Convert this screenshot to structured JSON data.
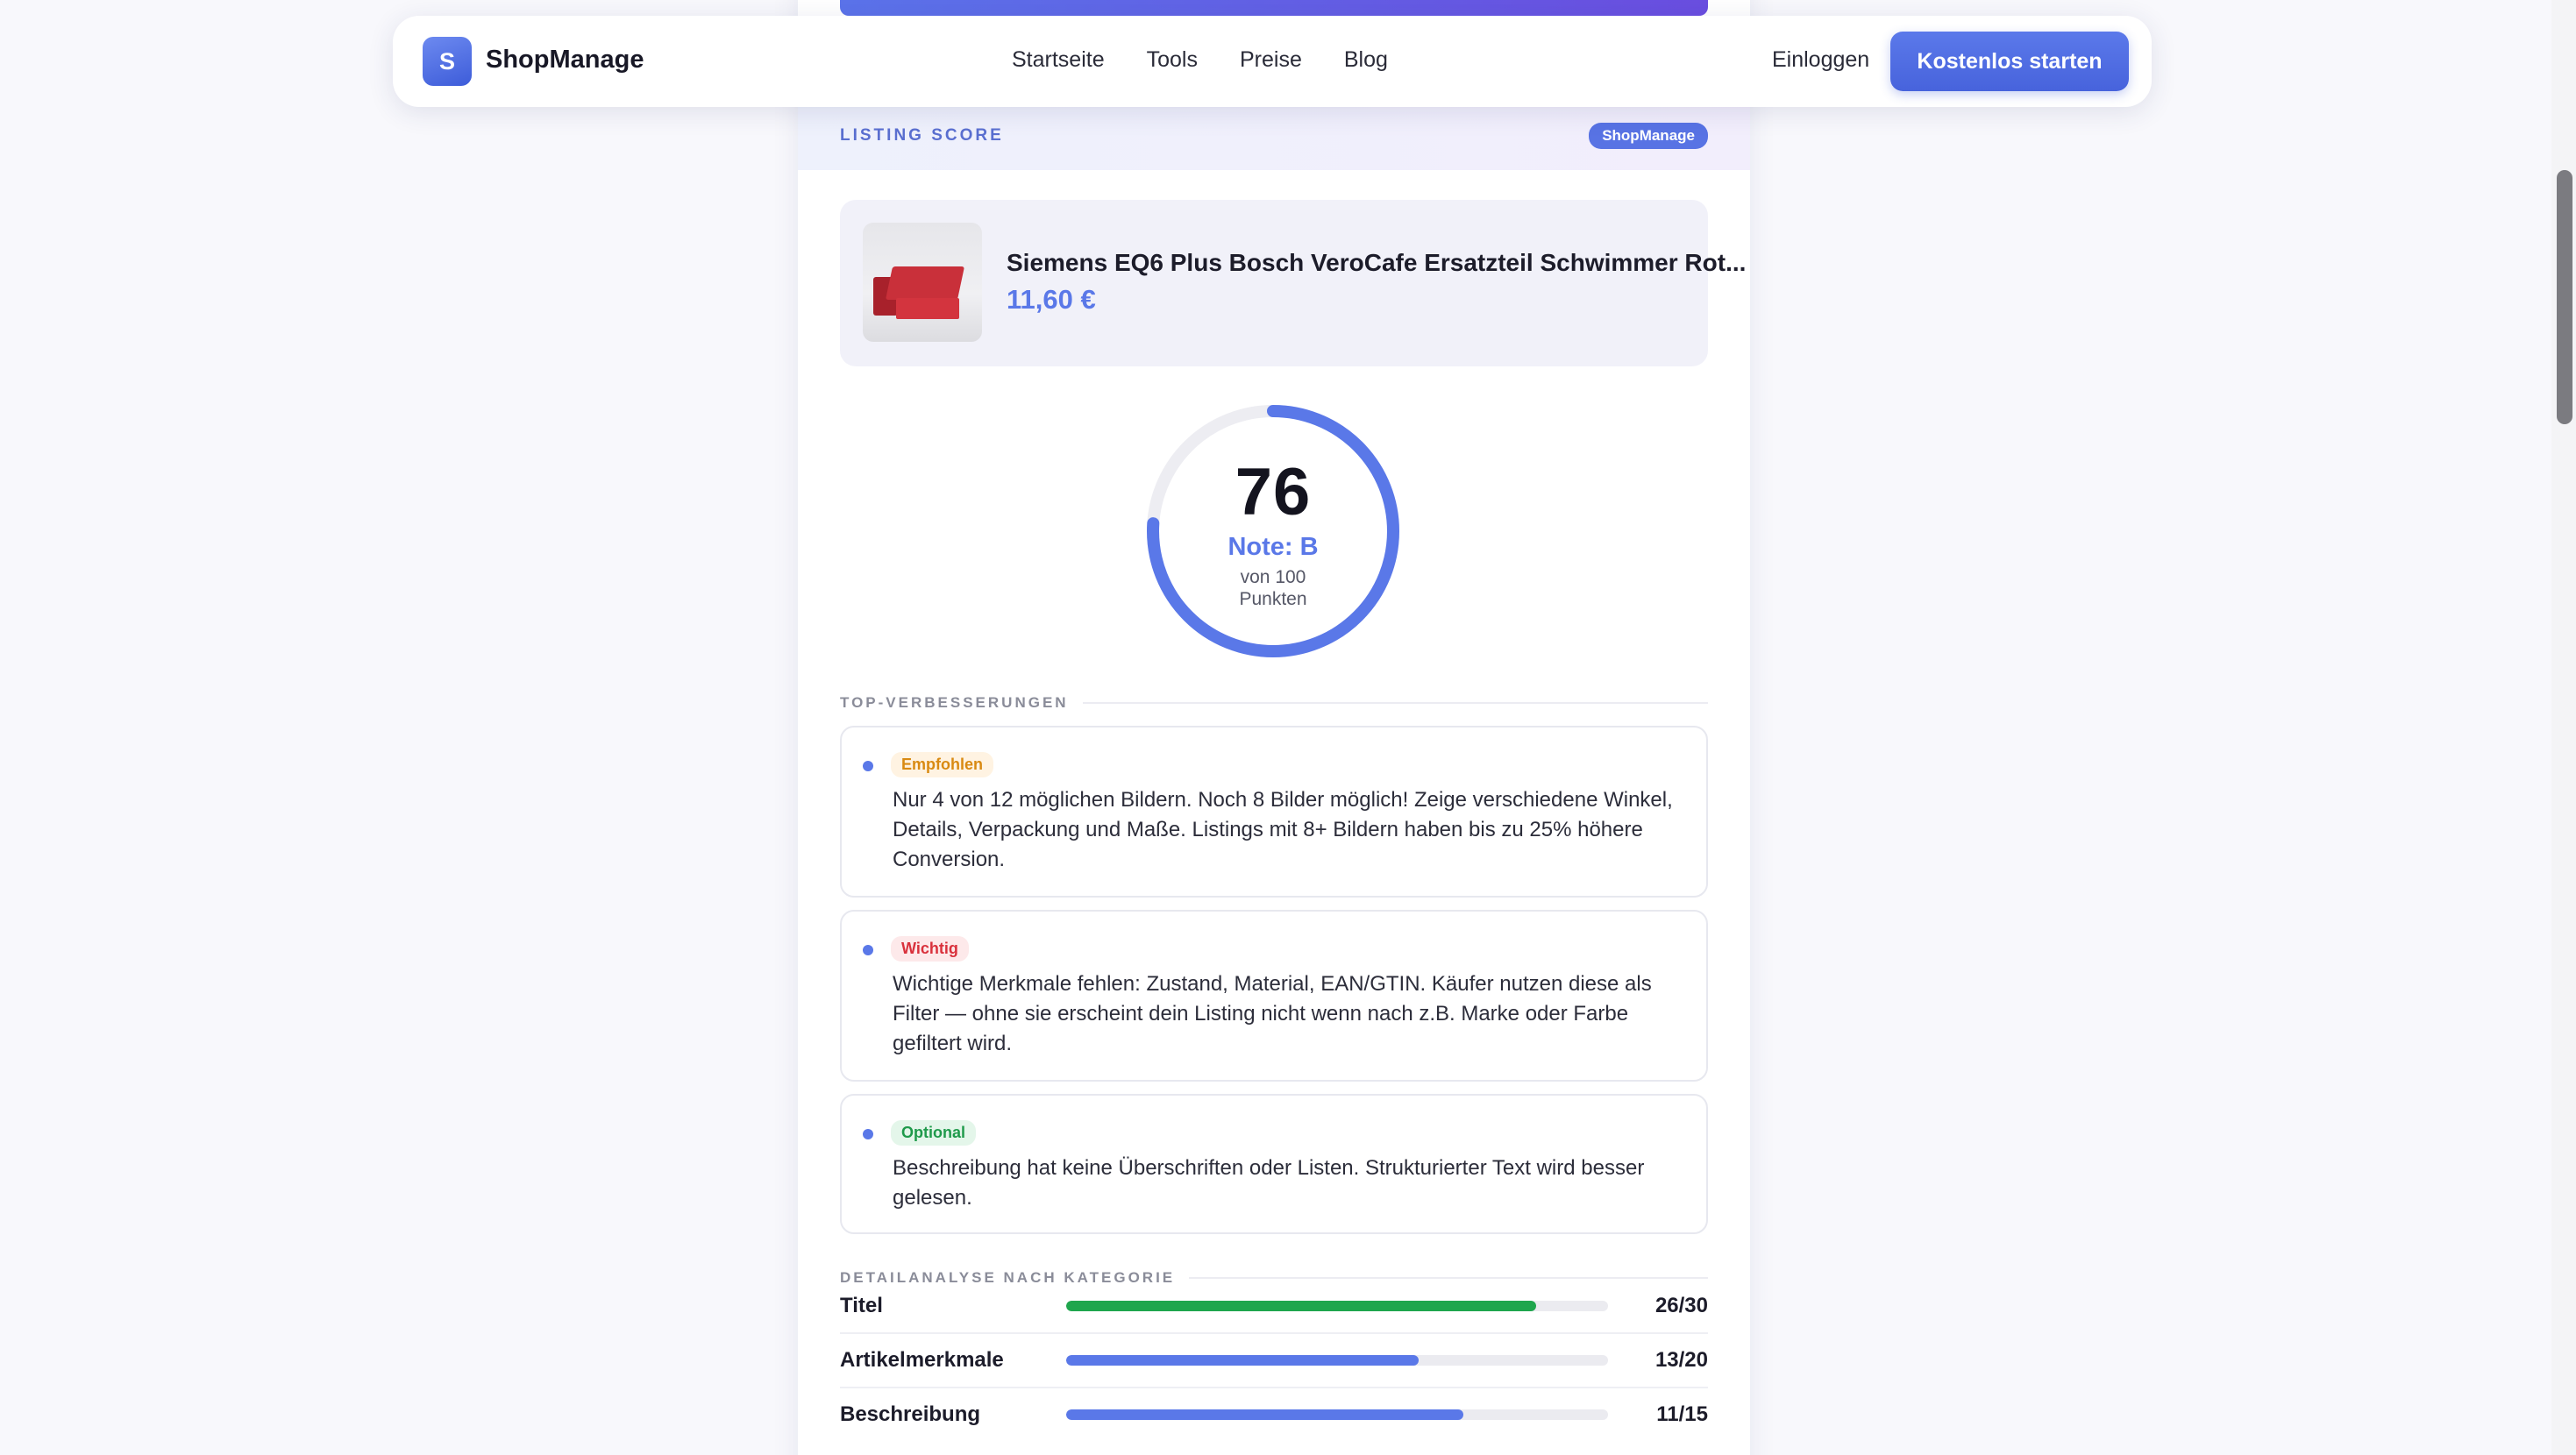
{
  "nav": {
    "logo_letter": "S",
    "brand": "ShopManage",
    "links": [
      "Startseite",
      "Tools",
      "Preise",
      "Blog"
    ],
    "login": "Einloggen",
    "cta": "Kostenlos starten"
  },
  "card": {
    "header_label": "LISTING SCORE",
    "header_badge": "ShopManage"
  },
  "product": {
    "title": "Siemens EQ6 Plus Bosch VeroCafe Ersatzteil Schwimmer Rot...",
    "price": "11,60 €"
  },
  "score": {
    "value": "76",
    "grade": "Note: B",
    "sub_line1": "von 100",
    "sub_line2": "Punkten",
    "fraction": 0.76,
    "ring_color": "#5a78e8"
  },
  "improvements": {
    "title": "TOP-VERBESSERUNGEN",
    "items": [
      {
        "tag": "Empfohlen",
        "text": "Nur 4 von 12 möglichen Bildern. Noch 8 Bilder möglich! Zeige verschiedene Winkel, Details, Verpackung und Maße. Listings mit 8+ Bildern haben bis zu 25% höhere Conversion."
      },
      {
        "tag": "Wichtig",
        "text": "Wichtige Merkmale fehlen: Zustand, Material, EAN/GTIN. Käufer nutzen diese als Filter — ohne sie erscheint dein Listing nicht wenn nach z.B. Marke oder Farbe gefiltert wird."
      },
      {
        "tag": "Optional",
        "text": "Beschreibung hat keine Überschriften oder Listen. Strukturierter Text wird besser gelesen."
      }
    ]
  },
  "details": {
    "title": "DETAILANALYSE NACH KATEGORIE",
    "rows": [
      {
        "name": "Titel",
        "value": "26/30",
        "fraction": 0.867,
        "color": "#1fa64d"
      },
      {
        "name": "Artikelmerkmale",
        "value": "13/20",
        "fraction": 0.65,
        "color": "#5a78e8"
      },
      {
        "name": "Beschreibung",
        "value": "11/15",
        "fraction": 0.733,
        "color": "#5a78e8"
      }
    ]
  }
}
